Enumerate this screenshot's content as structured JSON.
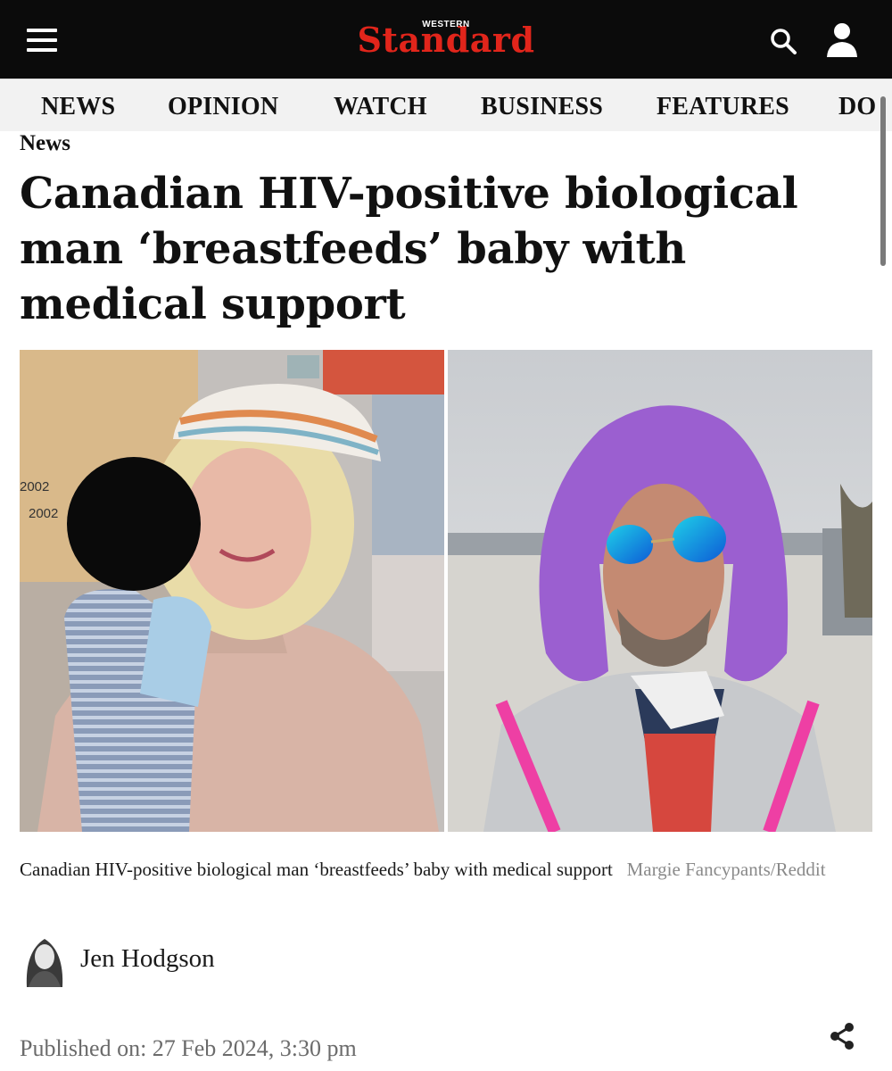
{
  "header": {
    "brand_small": "WESTERN",
    "brand_main": "Standard",
    "menu_icon": "hamburger-icon",
    "search_icon": "search-icon",
    "user_icon": "user-icon",
    "brand_color": "#e1251b",
    "bar_color": "#0b0b0b"
  },
  "nav": {
    "items": [
      "NEWS",
      "OPINION",
      "WATCH",
      "BUSINESS",
      "FEATURES",
      "DO"
    ]
  },
  "article": {
    "category": "News",
    "headline": "Canadian HIV-positive biological man ‘breastfeeds’ baby with medical support",
    "caption_text": "Canadian HIV-positive biological man ‘breastfeeds’ baby with medical support",
    "caption_credit": "Margie Fancypants/Reddit",
    "author": "Jen Hodgson",
    "published": "Published on: 27 Feb 2024, 3:30 pm",
    "share_icon": "share-icon"
  },
  "photo_left": {
    "wall_text": [
      "2002",
      "2002"
    ]
  }
}
